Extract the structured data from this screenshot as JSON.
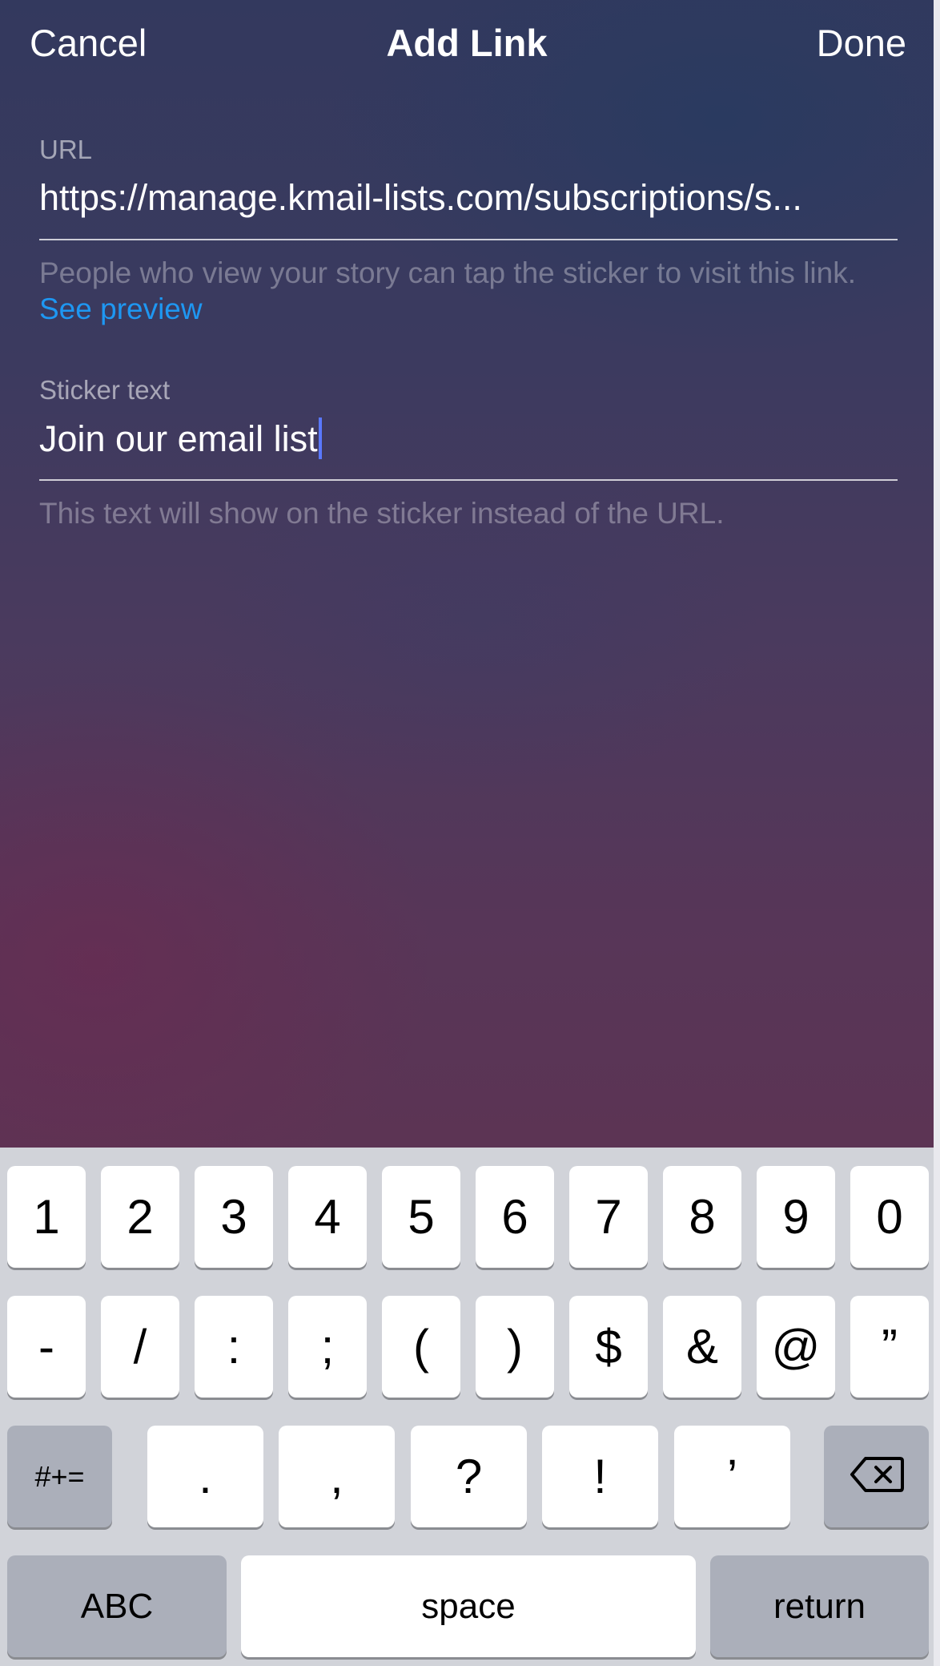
{
  "header": {
    "cancel_label": "Cancel",
    "title": "Add Link",
    "done_label": "Done"
  },
  "url_field": {
    "label": "URL",
    "value": "https://manage.kmail-lists.com/subscriptions/s...",
    "helper_text": "People who view your story can tap the sticker to visit this link.",
    "preview_link": "See preview"
  },
  "sticker_field": {
    "label": "Sticker text",
    "value": "Join our email list",
    "helper_text": "This text will show on the sticker instead of the URL."
  },
  "keyboard": {
    "row1": [
      "1",
      "2",
      "3",
      "4",
      "5",
      "6",
      "7",
      "8",
      "9",
      "0"
    ],
    "row2": [
      "-",
      "/",
      ":",
      ";",
      "(",
      ")",
      "$",
      "&",
      "@",
      "”"
    ],
    "row3": [
      ".",
      ",",
      "?",
      "!",
      "’"
    ],
    "symbols_toggle": "#+=",
    "backspace_icon": "backspace-icon",
    "abc_label": "ABC",
    "space_label": "space",
    "return_label": "return"
  },
  "colors": {
    "link": "#1e97f2",
    "caret": "#5a78ff",
    "keyboard_bg": "#d1d3d9",
    "function_key_bg": "#abafba"
  }
}
